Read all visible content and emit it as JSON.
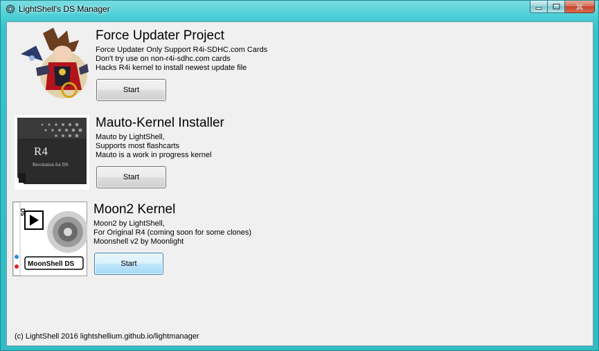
{
  "window": {
    "title": "LightShell's DS Manager"
  },
  "sections": [
    {
      "heading": "Force Updater Project",
      "lines": [
        "Force Updater Only Support R4i-SDHC.com Cards",
        "Don't try use on non-r4i-sdhc.com cards",
        "Hacks R4i kernel to install newest update file"
      ],
      "button": "Start"
    },
    {
      "heading": "Mauto-Kernel Installer",
      "lines": [
        "Mauto by LightShell,",
        "Supports most flashcarts",
        "Mauto is a work in progress kernel"
      ],
      "button": "Start",
      "card_logo": "R4",
      "card_subtext": "Revolution for DS"
    },
    {
      "heading": "Moon2 Kernel",
      "lines": [
        "Moon2 by LightShell,",
        "For Original R4 (coming soon for some clones)",
        "Moonshell v2 by Moonlight"
      ],
      "button": "Start",
      "box_side_text": "DS",
      "box_logo": "MoonShell DS"
    }
  ],
  "footer": "(c) LightShell 2016 lightshellium.github.io/lightmanager",
  "colors": {
    "title_bar": "#3fc7cf",
    "client_bg": "#f0f0f0",
    "close_button": "#c4432a"
  }
}
